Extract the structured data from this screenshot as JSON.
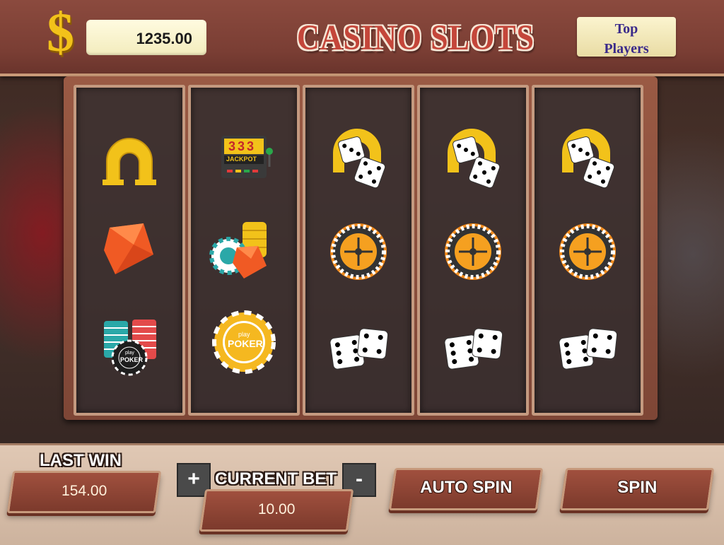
{
  "header": {
    "currency_symbol": "$",
    "balance": "1235.00",
    "title": "CASINO SLOTS",
    "top_players_line1": "Top",
    "top_players_line2": "Players"
  },
  "reels": [
    [
      "horseshoe-icon",
      "gem-icon",
      "chip-stack-poker-icon"
    ],
    [
      "jackpot-slot-machine-icon",
      "chips-gem-icon",
      "poker-chip-icon"
    ],
    [
      "horseshoe-dice-icon",
      "roulette-wheel-icon",
      "dice-pair-icon"
    ],
    [
      "horseshoe-dice-icon",
      "roulette-wheel-icon",
      "dice-pair-icon"
    ],
    [
      "horseshoe-dice-icon",
      "roulette-wheel-icon",
      "dice-pair-icon"
    ]
  ],
  "symbols": {
    "jackpot_digits": "333",
    "jackpot_label": "JACKPOT",
    "poker_chip_small": "play",
    "poker_chip_big": "POKER",
    "stack_chip_small": "play",
    "stack_chip_big": "POKER"
  },
  "controls": {
    "last_win_label": "LAST WIN",
    "last_win_value": "154.00",
    "current_bet_label": "CURRENT BET",
    "current_bet_value": "10.00",
    "plus": "+",
    "minus": "-",
    "auto_spin": "AUTO SPIN",
    "spin": "SPIN"
  },
  "colors": {
    "gold": "#f2c21a",
    "title_red": "#c4463a",
    "panel_brown": "#8b4a3e",
    "plate_brown": "#7c3a2c"
  }
}
